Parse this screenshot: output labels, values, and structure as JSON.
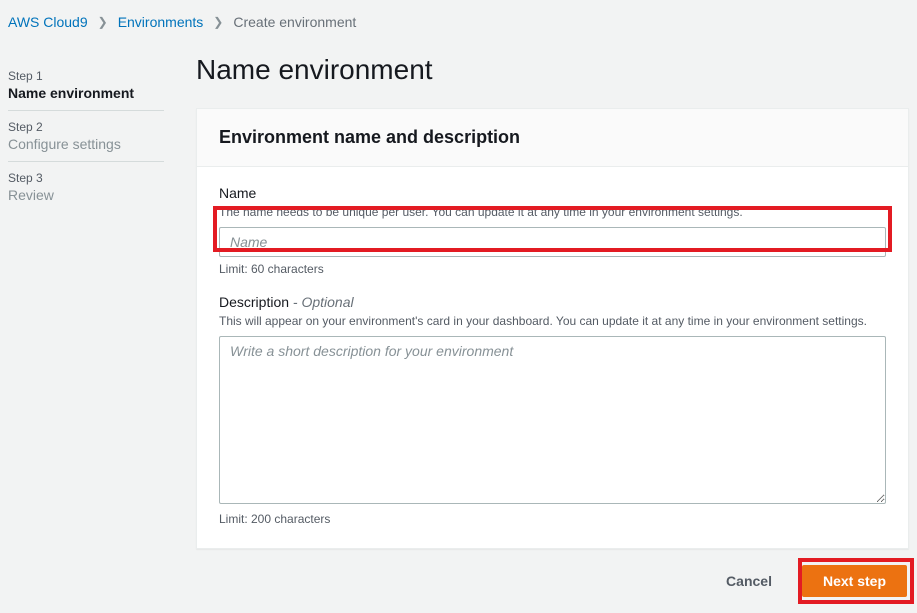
{
  "breadcrumbs": {
    "root": "AWS Cloud9",
    "env": "Environments",
    "current": "Create environment"
  },
  "sidebar": {
    "steps": [
      {
        "num": "Step 1",
        "title": "Name environment"
      },
      {
        "num": "Step 2",
        "title": "Configure settings"
      },
      {
        "num": "Step 3",
        "title": "Review"
      }
    ]
  },
  "page": {
    "title": "Name environment"
  },
  "panel": {
    "heading": "Environment name and description",
    "name": {
      "label": "Name",
      "hint": "The name needs to be unique per user. You can update it at any time in your environment settings.",
      "placeholder": "Name",
      "value": "",
      "limit": "Limit: 60 characters"
    },
    "description": {
      "label": "Description",
      "optional": "- Optional",
      "hint": "This will appear on your environment's card in your dashboard. You can update it at any time in your environment settings.",
      "placeholder": "Write a short description for your environment",
      "value": "",
      "limit": "Limit: 200 characters"
    }
  },
  "actions": {
    "cancel": "Cancel",
    "next": "Next step"
  }
}
